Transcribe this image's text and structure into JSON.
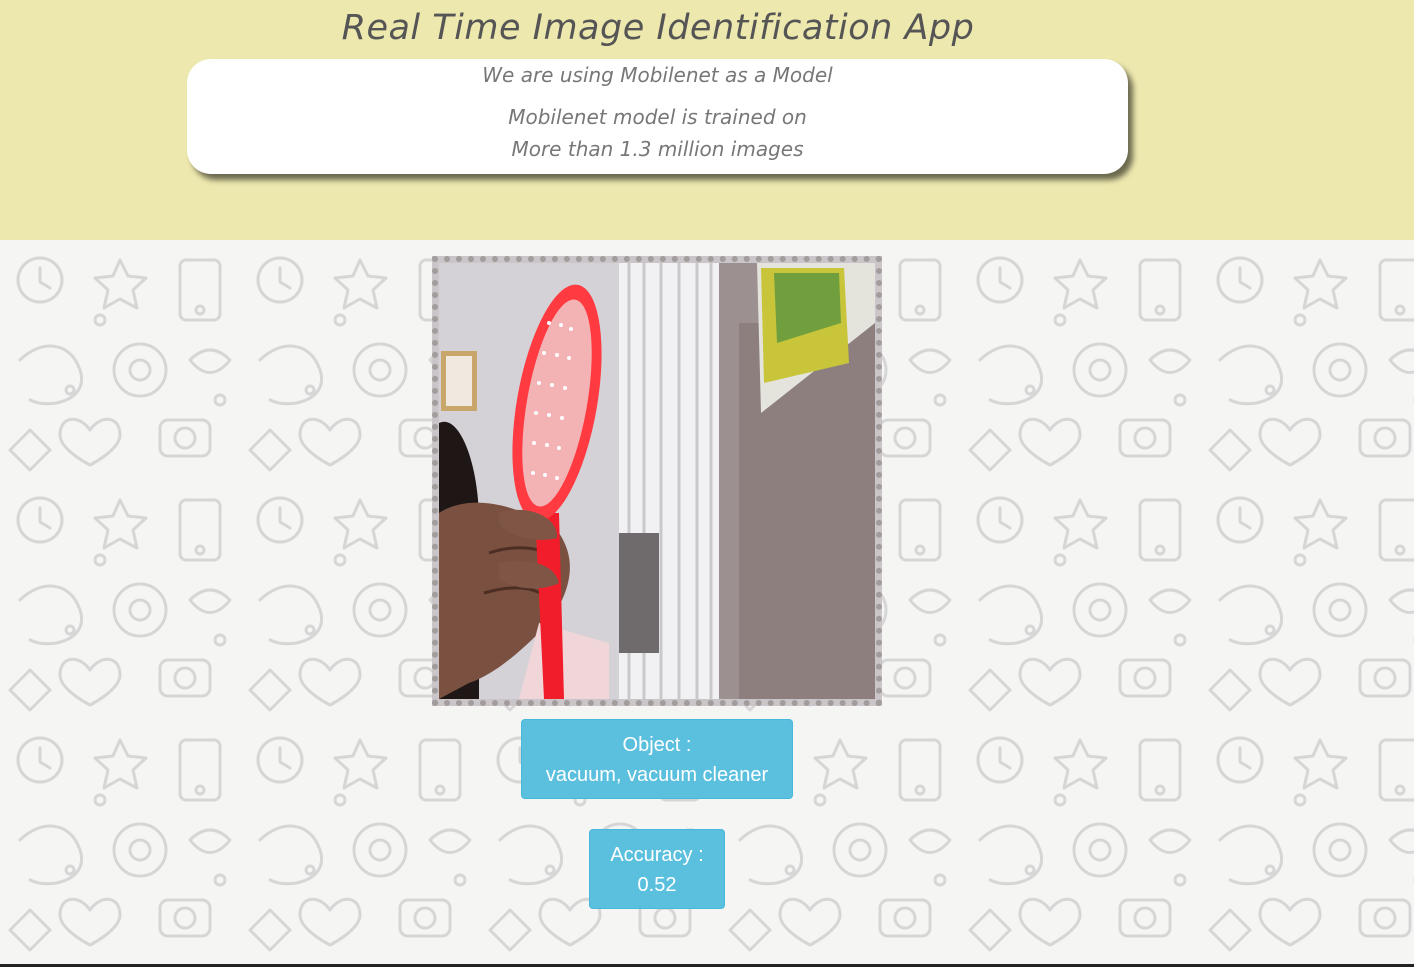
{
  "header": {
    "title": "Real Time Image Identification App",
    "info": {
      "line1": "We are using Mobilenet as a Model",
      "line2": "Mobilenet model is trained on",
      "line3": "More than 1.3 million images"
    }
  },
  "webcam": {
    "label": "webcam-feed"
  },
  "result": {
    "object_label": "Object :",
    "object_value": "vacuum, vacuum cleaner",
    "accuracy_label": "Accuracy :",
    "accuracy_value": "0.52"
  },
  "colors": {
    "header_bg": "#ede8ae",
    "result_bg": "#5bc0de",
    "frame_border": "#a39c9c"
  }
}
